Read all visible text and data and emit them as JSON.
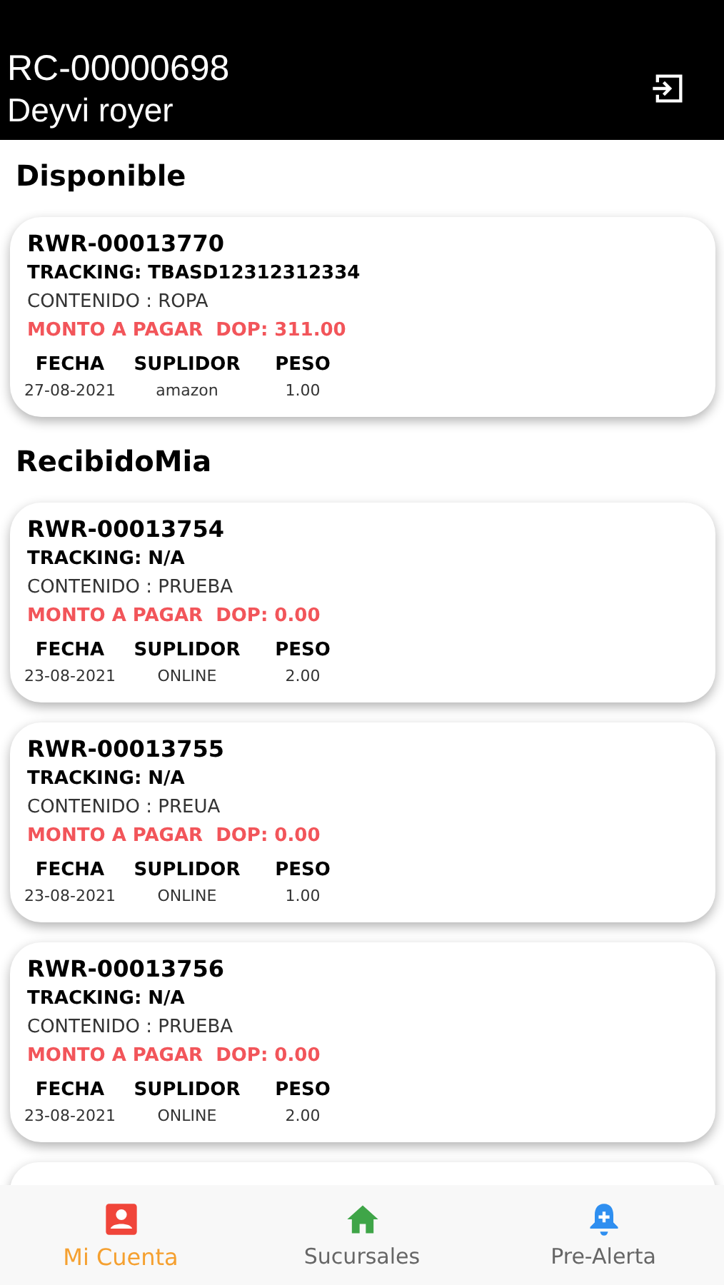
{
  "header": {
    "account": "RC-00000698",
    "name": "Deyvi royer"
  },
  "sections": [
    {
      "title": "Disponible",
      "packages": [
        {
          "id": "RWR-00013770",
          "tracking": "TRACKING: TBASD12312312334",
          "content": "CONTENIDO : ROPA",
          "amount": "MONTO A PAGAR  DOP: 311.00",
          "columns": [
            {
              "label": "FECHA",
              "value": "27-08-2021"
            },
            {
              "label": "SUPLIDOR",
              "value": "amazon"
            },
            {
              "label": "PESO",
              "value": "1.00"
            }
          ]
        }
      ]
    },
    {
      "title": "RecibidoMia",
      "packages": [
        {
          "id": "RWR-00013754",
          "tracking": "TRACKING: N/A",
          "content": "CONTENIDO : PRUEBA",
          "amount": "MONTO A PAGAR  DOP: 0.00",
          "columns": [
            {
              "label": "FECHA",
              "value": "23-08-2021"
            },
            {
              "label": "SUPLIDOR",
              "value": "ONLINE"
            },
            {
              "label": "PESO",
              "value": "2.00"
            }
          ]
        },
        {
          "id": "RWR-00013755",
          "tracking": "TRACKING: N/A",
          "content": "CONTENIDO : PREUA",
          "amount": "MONTO A PAGAR  DOP: 0.00",
          "columns": [
            {
              "label": "FECHA",
              "value": "23-08-2021"
            },
            {
              "label": "SUPLIDOR",
              "value": "ONLINE"
            },
            {
              "label": "PESO",
              "value": "1.00"
            }
          ]
        },
        {
          "id": "RWR-00013756",
          "tracking": "TRACKING: N/A",
          "content": "CONTENIDO : PRUEBA",
          "amount": "MONTO A PAGAR  DOP: 0.00",
          "columns": [
            {
              "label": "FECHA",
              "value": "23-08-2021"
            },
            {
              "label": "SUPLIDOR",
              "value": "ONLINE"
            },
            {
              "label": "PESO",
              "value": "2.00"
            }
          ]
        }
      ]
    }
  ],
  "tabs": [
    {
      "kind": "account",
      "label": "Mi Cuenta",
      "selected": true
    },
    {
      "kind": "branches",
      "label": "Sucursales",
      "selected": false
    },
    {
      "kind": "alert",
      "label": "Pre-Alerta",
      "selected": false
    }
  ]
}
